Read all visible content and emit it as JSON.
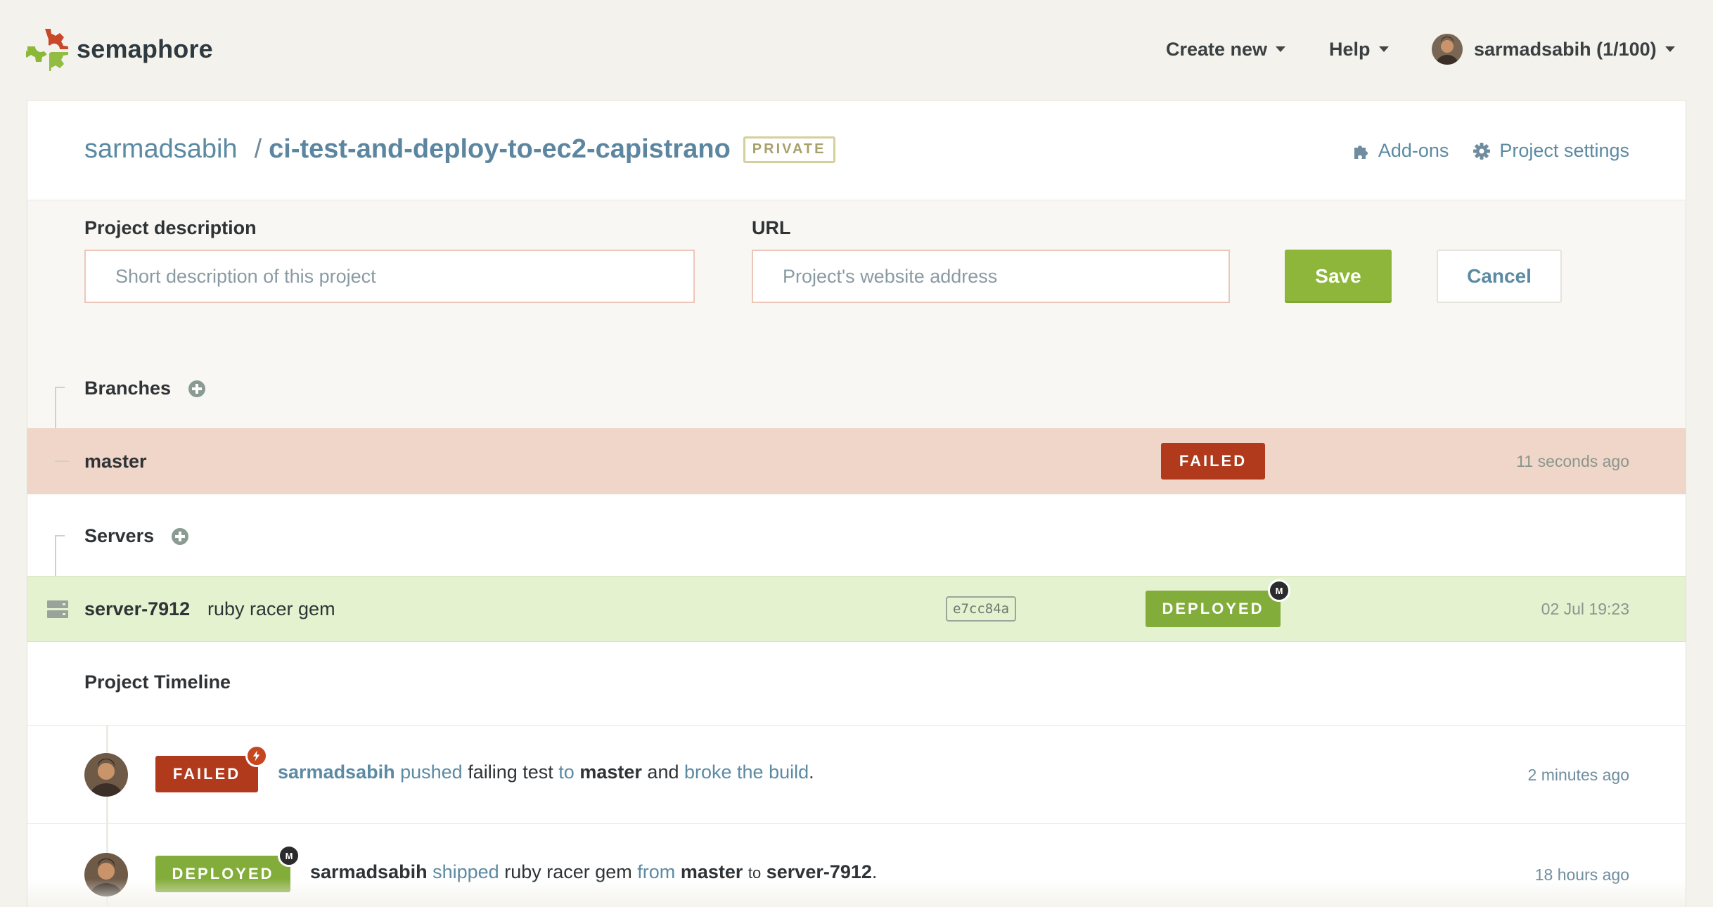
{
  "nav": {
    "brand": "semaphore",
    "create_new": "Create new",
    "help": "Help",
    "user": "sarmadsabih (1/100)"
  },
  "project": {
    "owner": "sarmadsabih",
    "separator": "/",
    "name": "ci-test-and-deploy-to-ec2-capistrano",
    "visibility_badge": "PRIVATE",
    "addons_label": "Add-ons",
    "settings_label": "Project settings"
  },
  "form": {
    "description_label": "Project description",
    "description_value": "",
    "description_placeholder": "Short description of this project",
    "url_label": "URL",
    "url_value": "",
    "url_placeholder": "Project's website address",
    "save_label": "Save",
    "cancel_label": "Cancel"
  },
  "branches": {
    "title": "Branches",
    "items": [
      {
        "name": "master",
        "status": "FAILED",
        "time": "11 seconds ago"
      }
    ]
  },
  "servers": {
    "title": "Servers",
    "items": [
      {
        "name": "server-7912",
        "description": "ruby racer gem",
        "commit": "e7cc84a",
        "status": "DEPLOYED",
        "corner": "M",
        "time": "02 Jul 19:23"
      }
    ]
  },
  "timeline": {
    "title": "Project Timeline",
    "items": [
      {
        "status": "FAILED",
        "user": "sarmadsabih",
        "verb": "pushed",
        "object": "failing test",
        "prep": "to",
        "branch": "master",
        "conj": "and",
        "result": "broke the build",
        "end": ".",
        "time": "2 minutes ago"
      },
      {
        "status": "DEPLOYED",
        "corner": "M",
        "user": "sarmadsabih",
        "verb": "shipped",
        "object": "ruby racer gem",
        "prep": "from",
        "branch": "master",
        "prep2": "to",
        "server": "server-7912",
        "end": ".",
        "time": "18 hours ago"
      }
    ]
  },
  "colors": {
    "accent_link": "#5b8aa3",
    "failed": "#b13a1c",
    "deployed": "#83ad3a",
    "save_button": "#8db63a",
    "failed_row_bg": "#efd6c8",
    "deployed_row_bg": "#e4f2cf"
  },
  "icons": {
    "logo": "gear-logo-icon",
    "addons": "puzzle-icon",
    "settings": "gear-icon",
    "add": "plus-circle-icon",
    "server": "server-icon",
    "failed_corner": "lightning-icon"
  }
}
